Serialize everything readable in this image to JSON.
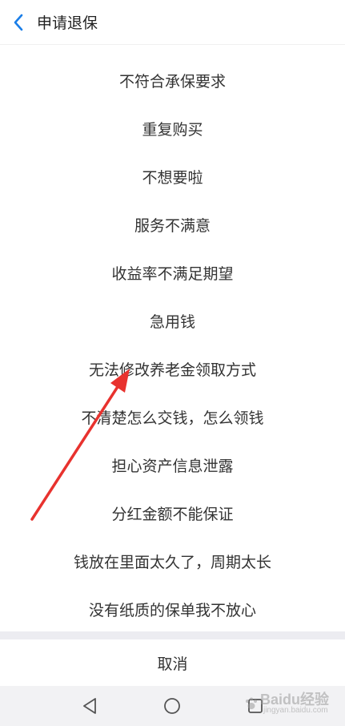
{
  "header": {
    "back_icon": "chevron-left-icon",
    "title": "申请退保"
  },
  "reasons": [
    "不符合承保要求",
    "重复购买",
    "不想要啦",
    "服务不满意",
    "收益率不满足期望",
    "急用钱",
    "无法修改养老金领取方式",
    "不清楚怎么交钱，怎么领钱",
    "担心资产信息泄露",
    "分红金额不能保证",
    "钱放在里面太久了，周期太长",
    "没有纸质的保单我不放心"
  ],
  "cancel_label": "取消",
  "nav": {
    "back_icon": "triangle-back-icon",
    "home_icon": "circle-home-icon",
    "recents_icon": "square-recents-icon"
  },
  "watermark": {
    "text": "Baidu经验",
    "sub": "jingyan.baidu.com"
  },
  "colors": {
    "accent": "#1a7ee8",
    "arrow": "#e8322e",
    "band": "#ececf1"
  }
}
